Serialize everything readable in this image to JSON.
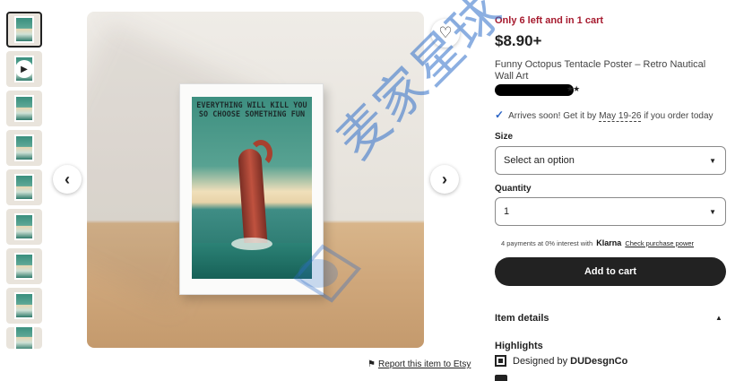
{
  "listing": {
    "stock_text": "Only 6 left and in 1 cart",
    "price": "$8.90+",
    "title": "Funny Octopus Tentacle Poster – Retro Nautical Wall Art",
    "shipping_prefix": "Arrives soon! Get it by",
    "shipping_date": "May 19-26",
    "shipping_suffix": "if you order today"
  },
  "poster_text": "EVERYTHING WILL KILL YOU SO CHOOSE SOMETHING FUN",
  "size": {
    "label": "Size",
    "selected": "Select an option"
  },
  "quantity": {
    "label": "Quantity",
    "selected": "1"
  },
  "klarna": {
    "text": "4 payments at 0% interest with",
    "brand": "Klarna",
    "link": "Check purchase power"
  },
  "add_to_cart": "Add to cart",
  "item_details": "Item details",
  "highlights": {
    "heading": "Highlights",
    "designed_by_prefix": "Designed by",
    "designer": "DUDesgnCo"
  },
  "report_link": "Report this item to Etsy",
  "watermark": "麦家星球",
  "icons": {
    "favorite": "heart-icon",
    "prev": "chevron-left-icon",
    "next": "chevron-right-icon",
    "play": "play-icon",
    "flag": "flag-icon",
    "check": "check-icon"
  },
  "colors": {
    "stock_red": "#a61a2e",
    "cart_button": "#222222",
    "check_blue": "#2c65c6"
  }
}
